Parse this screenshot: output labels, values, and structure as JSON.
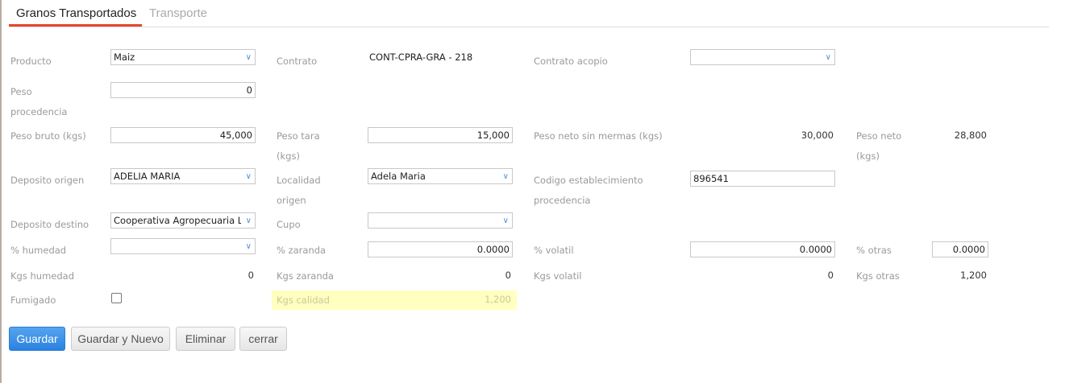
{
  "tabs": [
    {
      "label": "Granos Transportados",
      "active": true
    },
    {
      "label": "Transporte",
      "active": false
    }
  ],
  "accent_color": "#e8452c",
  "form": {
    "producto": {
      "label": "Producto",
      "value": "Maiz"
    },
    "contrato": {
      "label": "Contrato",
      "value": "CONT-CPRA-GRA - 218"
    },
    "contrato_acopio": {
      "label": "Contrato acopio",
      "value": ""
    },
    "peso_procedencia": {
      "label1": "Peso",
      "label2": "procedencia",
      "value": "0"
    },
    "peso_bruto": {
      "label": "Peso bruto (kgs)",
      "value": "45,000"
    },
    "peso_tara": {
      "label1": "Peso tara",
      "label2": "(kgs)",
      "value": "15,000"
    },
    "peso_neto_sin_mermas": {
      "label": "Peso neto sin mermas (kgs)",
      "value": "30,000"
    },
    "peso_neto": {
      "label1": "Peso neto",
      "label2": "(kgs)",
      "value": "28,800"
    },
    "deposito_origen": {
      "label": "Deposito origen",
      "value": "ADELIA MARIA"
    },
    "localidad_origen": {
      "label1": "Localidad",
      "label2": "origen",
      "value": "Adela Maria"
    },
    "codigo_establecimiento": {
      "label1": "Codigo establecimiento",
      "label2": "procedencia",
      "value": "896541"
    },
    "deposito_destino": {
      "label": "Deposito destino",
      "value": "Cooperativa Agropecuaria L"
    },
    "cupo": {
      "label": "Cupo",
      "value": ""
    },
    "pct_humedad": {
      "label": "% humedad",
      "value": ""
    },
    "pct_zaranda": {
      "label": "% zaranda",
      "value": "0.0000"
    },
    "pct_volatil": {
      "label": "% volatil",
      "value": "0.0000"
    },
    "pct_otras": {
      "label": "% otras",
      "value": "0.0000"
    },
    "kgs_humedad": {
      "label": "Kgs humedad",
      "value": "0"
    },
    "kgs_zaranda": {
      "label": "Kgs zaranda",
      "value": "0"
    },
    "kgs_volatil": {
      "label": "Kgs volatil",
      "value": "0"
    },
    "kgs_otras": {
      "label": "Kgs otras",
      "value": "1,200"
    },
    "fumigado": {
      "label": "Fumigado",
      "checked": false
    },
    "kgs_calidad": {
      "label": "Kgs calidad",
      "value": "1,200"
    }
  },
  "buttons": {
    "guardar": "Guardar",
    "guardar_nuevo": "Guardar y Nuevo",
    "eliminar": "Eliminar",
    "cerrar": "cerrar"
  }
}
